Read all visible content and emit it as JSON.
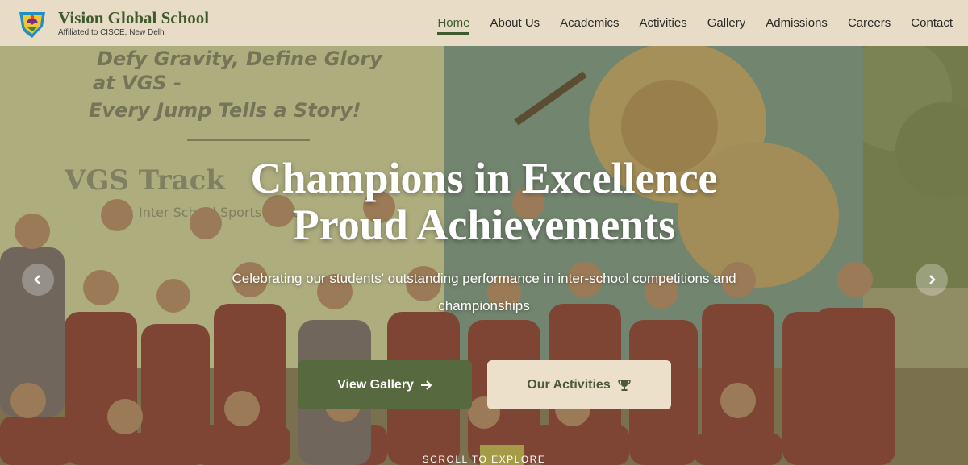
{
  "brand": {
    "name": "Vision Global School",
    "subtitle": "Affiliated to CISCE, New Delhi",
    "logo_icon": "school-crest-icon"
  },
  "nav": {
    "items": [
      "Home",
      "About Us",
      "Academics",
      "Activities",
      "Gallery",
      "Admissions",
      "Careers",
      "Contact"
    ],
    "active": "Home"
  },
  "hero": {
    "title_line1": "Champions in Excellence",
    "title_line2": "Proud Achievements",
    "subtitle": "Celebrating our students' outstanding performance in inter-school competitions and championships",
    "primary_button": "View Gallery",
    "primary_icon": "arrow-right-icon",
    "secondary_button": "Our Activities",
    "secondary_icon": "trophy-icon",
    "scroll_hint": "SCROLL TO EXPLORE",
    "banner_text": [
      "Defy Gravity, Define Glory",
      "at VGS -",
      "Every Jump Tells a Story!",
      "VGS Track",
      "Inter School Sports Meet"
    ]
  },
  "colors": {
    "header_bg": "#e9dcc6",
    "brand_green": "#3f5a2c",
    "button_primary": "#57693f",
    "button_secondary": "#ece0cb"
  }
}
